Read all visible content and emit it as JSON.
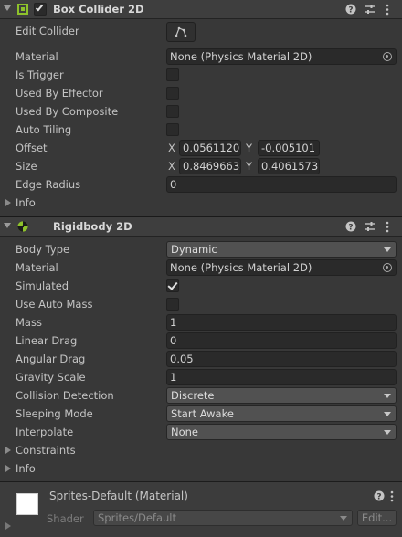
{
  "box_collider": {
    "title": "Box Collider 2D",
    "edit_collider_label": "Edit Collider",
    "material_label": "Material",
    "material_value": "None (Physics Material 2D)",
    "is_trigger_label": "Is Trigger",
    "is_trigger": false,
    "used_by_effector_label": "Used By Effector",
    "used_by_effector": false,
    "used_by_composite_label": "Used By Composite",
    "used_by_composite": false,
    "auto_tiling_label": "Auto Tiling",
    "auto_tiling": false,
    "offset_label": "Offset",
    "offset_x_label": "X",
    "offset_x": "0.0561120",
    "offset_y_label": "Y",
    "offset_y": "-0.005101",
    "size_label": "Size",
    "size_x_label": "X",
    "size_x": "0.8469663",
    "size_y_label": "Y",
    "size_y": "0.4061573",
    "edge_radius_label": "Edge Radius",
    "edge_radius": "0",
    "info_label": "Info"
  },
  "rigidbody": {
    "title": "Rigidbody 2D",
    "body_type_label": "Body Type",
    "body_type": "Dynamic",
    "material_label": "Material",
    "material_value": "None (Physics Material 2D)",
    "simulated_label": "Simulated",
    "simulated": true,
    "use_auto_mass_label": "Use Auto Mass",
    "use_auto_mass": false,
    "mass_label": "Mass",
    "mass": "1",
    "linear_drag_label": "Linear Drag",
    "linear_drag": "0",
    "angular_drag_label": "Angular Drag",
    "angular_drag": "0.05",
    "gravity_scale_label": "Gravity Scale",
    "gravity_scale": "1",
    "collision_detection_label": "Collision Detection",
    "collision_detection": "Discrete",
    "sleeping_mode_label": "Sleeping Mode",
    "sleeping_mode": "Start Awake",
    "interpolate_label": "Interpolate",
    "interpolate": "None",
    "constraints_label": "Constraints",
    "info_label": "Info"
  },
  "material_panel": {
    "title": "Sprites-Default (Material)",
    "shader_label": "Shader",
    "shader_value": "Sprites/Default",
    "edit_button": "Edit..."
  },
  "icons": {
    "component_enable": "checkbox-icon",
    "help": "help-icon",
    "presets": "presets-icon",
    "menu": "kebab-menu-icon",
    "edit_collider": "edit-collider-icon",
    "object_picker": "object-picker-icon",
    "box_collider": "box-collider-icon",
    "rigidbody": "rigidbody-icon"
  },
  "colors": {
    "accent_green": "#8ec22b",
    "panel_bg": "#383838",
    "header_bg": "#3e3e3e",
    "field_bg": "#2a2a2a",
    "dropdown_bg": "#515151"
  }
}
